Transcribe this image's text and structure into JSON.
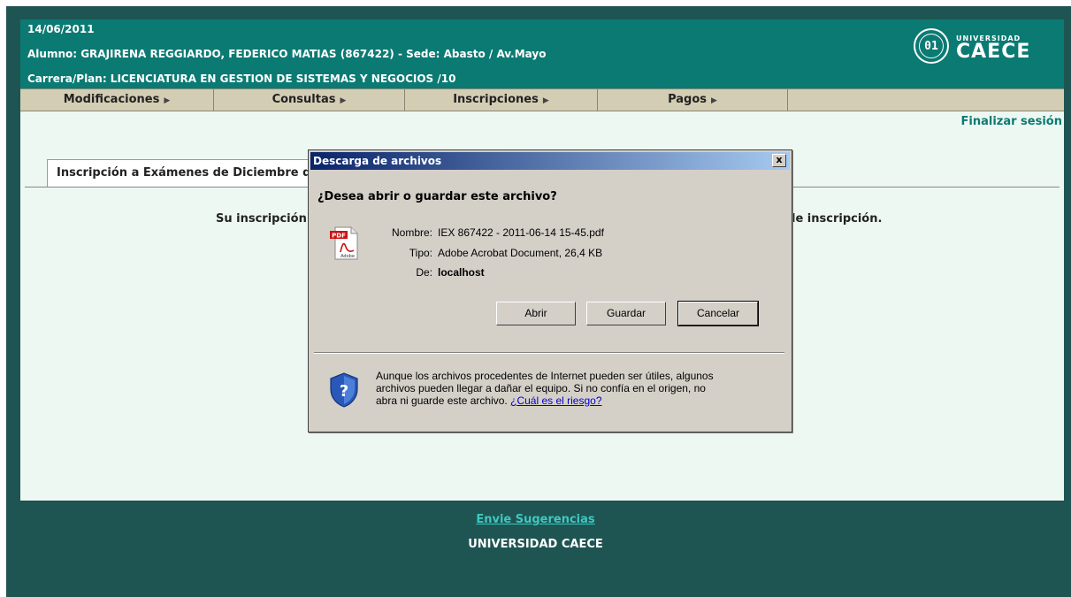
{
  "header": {
    "date": "14/06/2011",
    "student": "Alumno: GRAJIRENA REGGIARDO, FEDERICO MATIAS (867422) - Sede: Abasto / Av.Mayo",
    "career": "Carrera/Plan: LICENCIATURA EN GESTION DE SISTEMAS Y NEGOCIOS /10",
    "logo_seal": "01",
    "logo_small": "UNIVERSIDAD",
    "logo_name": "CAECE"
  },
  "menu": {
    "items": [
      {
        "label": "Modificaciones"
      },
      {
        "label": "Consultas"
      },
      {
        "label": "Inscripciones"
      },
      {
        "label": "Pagos"
      }
    ]
  },
  "content": {
    "logout": "Finalizar sesión",
    "tab_label": "Inscripción a Exámenes de Diciembre de",
    "message_left": "Su inscripción",
    "message_right": "le inscripción."
  },
  "footer": {
    "link": "Envie Sugerencias",
    "name": "UNIVERSIDAD CAECE"
  },
  "dialog": {
    "title": "Descarga de archivos",
    "close": "x",
    "question": "¿Desea abrir o guardar este archivo?",
    "name_label": "Nombre:",
    "name_value": "IEX 867422 - 2011-06-14 15-45.pdf",
    "type_label": "Tipo:",
    "type_value": "Adobe Acrobat Document, 26,4 KB",
    "from_label": "De:",
    "from_value": "localhost",
    "btn_open": "Abrir",
    "btn_save": "Guardar",
    "btn_cancel": "Cancelar",
    "warning": "Aunque los archivos procedentes de Internet pueden ser útiles, algunos archivos pueden llegar a dañar el equipo. Si no confía en el origen, no abra ni guarde este archivo.",
    "risk_link": "¿Cuál es el riesgo?",
    "pdf_badge": "PDF",
    "pdf_brand": "Adobe"
  }
}
